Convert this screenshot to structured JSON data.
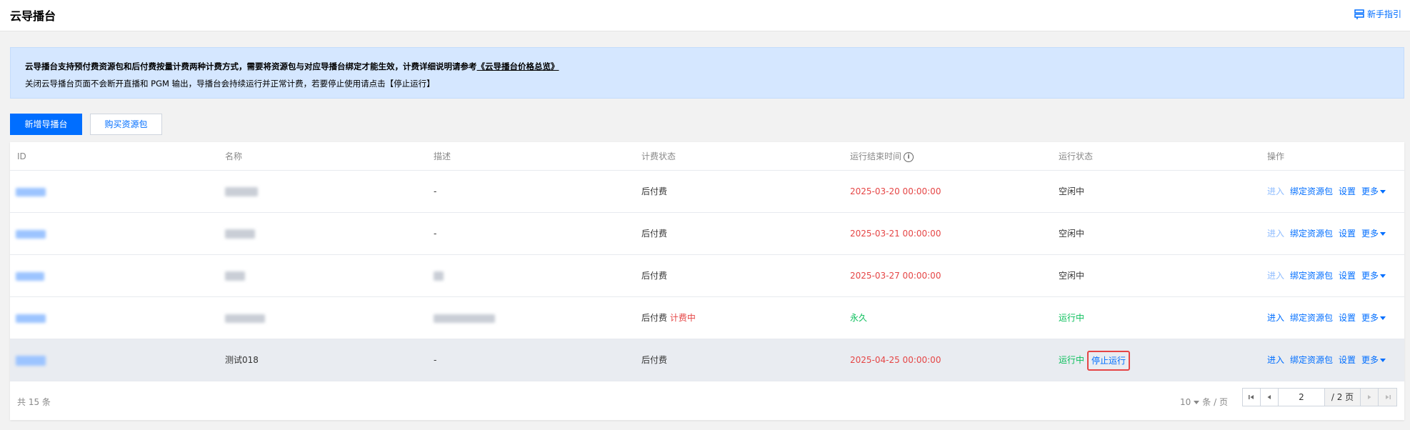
{
  "header": {
    "title": "云导播台",
    "guide_label": "新手指引"
  },
  "notice": {
    "line1_text": "云导播台支持预付费资源包和后付费按量计费两种计费方式，需要将资源包与对应导播台绑定才能生效，计费详细说明请参考",
    "line1_link": "《云导播台价格总览》",
    "line2_text": "关闭云导播台页面不会断开直播和 PGM 输出，导播台会持续运行并正常计费，若要停止使用请点击【停止运行】"
  },
  "toolbar": {
    "create_label": "新增导播台",
    "buy_label": "购买资源包"
  },
  "table": {
    "columns": [
      "ID",
      "名称",
      "描述",
      "计费状态",
      "运行结束时间",
      "运行状态",
      "操作"
    ],
    "rows": [
      {
        "desc": "-",
        "billing": "后付费",
        "billing_extra": "",
        "end_time": "2025-03-20 00:00:00",
        "status": "空闲中",
        "enter": "进入"
      },
      {
        "desc": "-",
        "billing": "后付费",
        "billing_extra": "",
        "end_time": "2025-03-21 00:00:00",
        "status": "空闲中",
        "enter": "进入"
      },
      {
        "desc": "",
        "billing": "后付费",
        "billing_extra": "",
        "end_time": "2025-03-27 00:00:00",
        "status": "空闲中",
        "enter": "进入"
      },
      {
        "desc": "",
        "billing": "后付费",
        "billing_extra": "计费中",
        "end_time": "永久",
        "status": "运行中",
        "enter": "进入"
      },
      {
        "name": "测试018",
        "desc": "-",
        "billing": "后付费",
        "billing_extra": "",
        "end_time": "2025-04-25 00:00:00",
        "status": "运行中",
        "stop_label": "停止运行",
        "enter": "进入"
      }
    ],
    "ops": {
      "bind": "绑定资源包",
      "settings": "设置",
      "more": "更多"
    }
  },
  "pagination": {
    "total_text": "共 15 条",
    "page_size": "10",
    "page_size_unit": "条 / 页",
    "current_page": "2",
    "total_pages": "/ 2 页"
  },
  "colors": {
    "primary": "#006eff",
    "danger": "#e54545",
    "success": "#0abf5b",
    "notice_bg": "#d5e7ff"
  }
}
